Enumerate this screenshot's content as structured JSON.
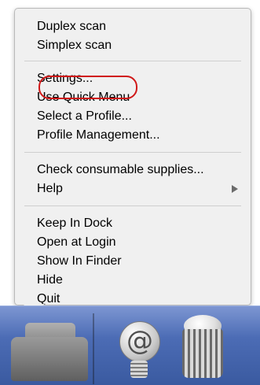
{
  "menu": {
    "group1": [
      "Duplex scan",
      "Simplex scan"
    ],
    "group2": [
      "Settings...",
      "Use Quick Menu",
      "Select a Profile...",
      "Profile Management..."
    ],
    "group3": [
      "Check consumable supplies...",
      "Help"
    ],
    "group4": [
      "Keep In Dock",
      "Open at Login",
      "Show In Finder",
      "Hide",
      "Quit"
    ]
  },
  "dock": {
    "icons": [
      "scanner-app-icon",
      "mail-icon",
      "trash-icon"
    ],
    "mail_symbol": "@"
  },
  "highlight_color": "#d01818"
}
